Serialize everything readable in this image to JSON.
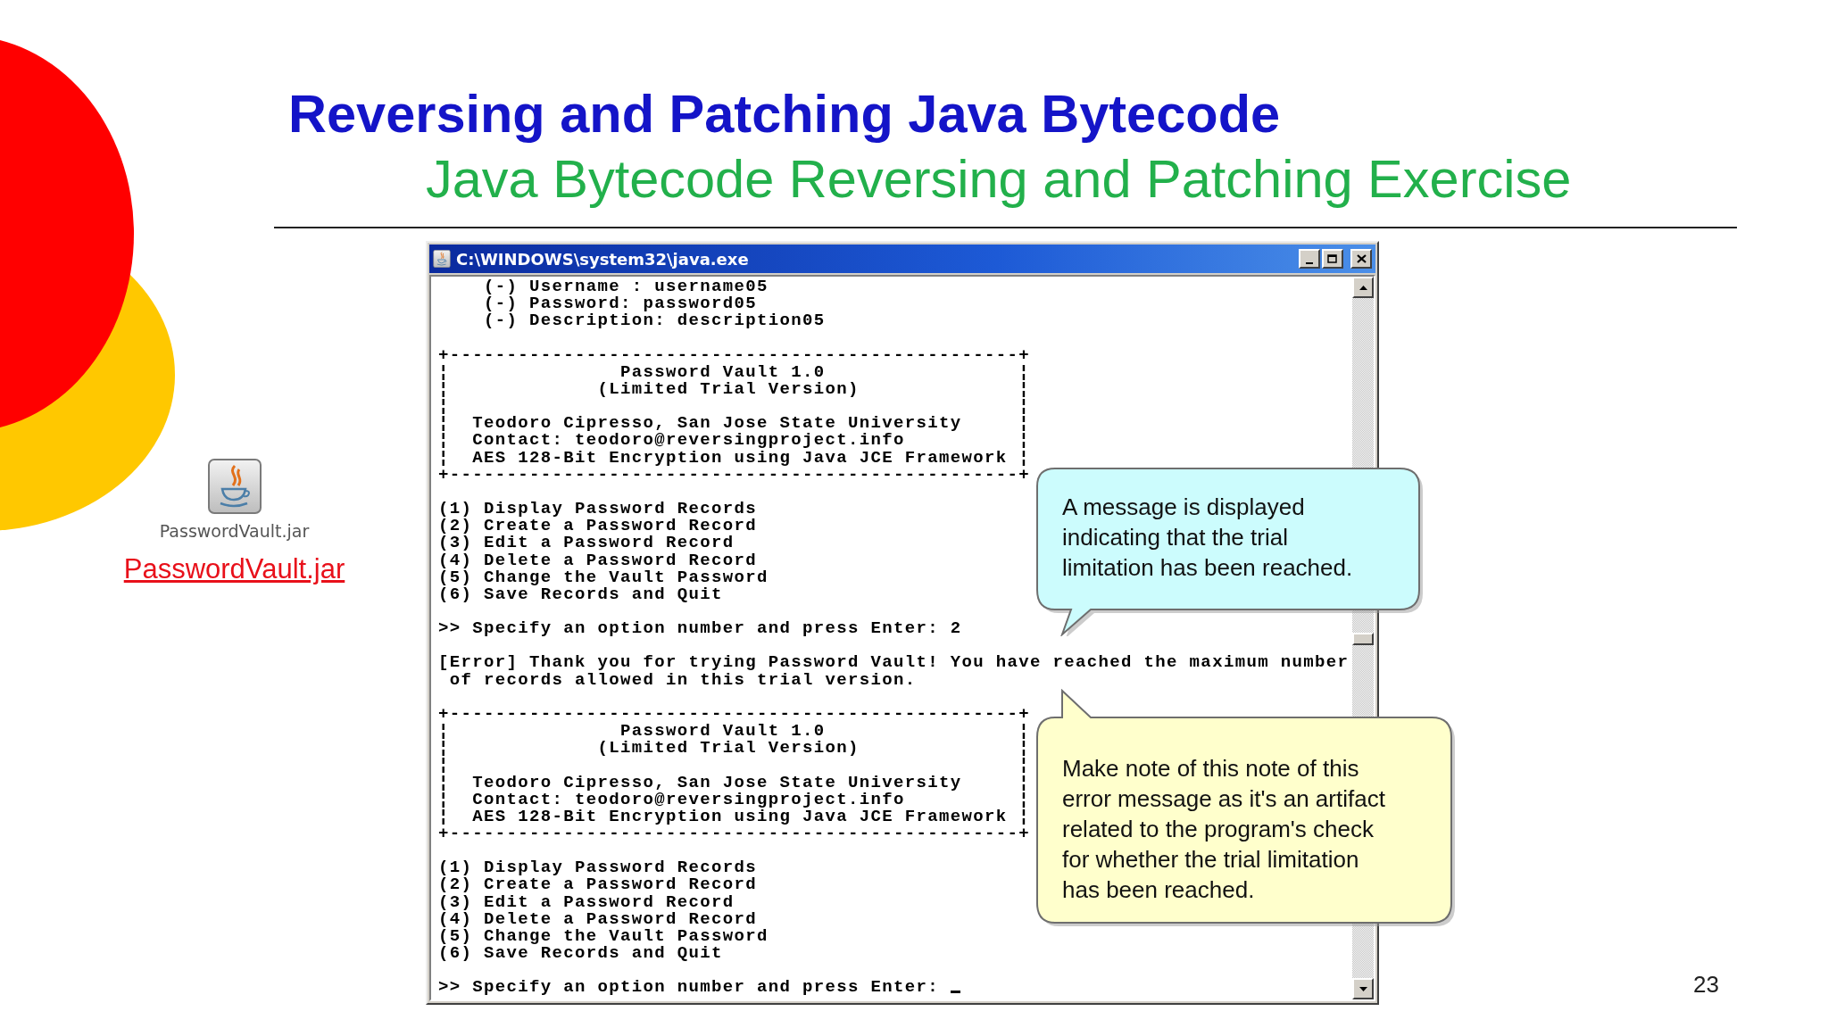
{
  "slide": {
    "title": "Reversing and Patching Java Bytecode",
    "subtitle": "Java Bytecode Reversing and Patching Exercise",
    "page_number": "23"
  },
  "file_icon": {
    "label": "PasswordVault.jar"
  },
  "link": {
    "text": "PasswordVault.jar"
  },
  "console": {
    "title": "C:\\WINDOWS\\system32\\java.exe",
    "lines": [
      {
        "kind": "text",
        "text": "    (-) Username : username05"
      },
      {
        "kind": "text",
        "text": "    (-) Password: password05"
      },
      {
        "kind": "text",
        "text": "    (-) Description: description05"
      },
      {
        "kind": "blank"
      },
      {
        "kind": "text",
        "text": "+--------------------------------------------------+"
      },
      {
        "kind": "text",
        "text": "¦               Password Vault 1.0                 ¦"
      },
      {
        "kind": "text",
        "text": "¦             (Limited Trial Version)              ¦"
      },
      {
        "kind": "text",
        "text": "¦                                                  ¦"
      },
      {
        "kind": "text",
        "text": "¦  Teodoro Cipresso, San Jose State University     ¦"
      },
      {
        "kind": "text",
        "text": "¦  Contact: teodoro@reversingproject.info          ¦"
      },
      {
        "kind": "text",
        "text": "¦  AES 128-Bit Encryption using Java JCE Framework ¦"
      },
      {
        "kind": "text",
        "text": "+--------------------------------------------------+"
      },
      {
        "kind": "blank"
      },
      {
        "kind": "text",
        "text": "(1) Display Password Records"
      },
      {
        "kind": "text",
        "text": "(2) Create a Password Record"
      },
      {
        "kind": "text",
        "text": "(3) Edit a Password Record"
      },
      {
        "kind": "text",
        "text": "(4) Delete a Password Record"
      },
      {
        "kind": "text",
        "text": "(5) Change the Vault Password"
      },
      {
        "kind": "text",
        "text": "(6) Save Records and Quit"
      },
      {
        "kind": "blank"
      },
      {
        "kind": "text",
        "text": ">> Specify an option number and press Enter: 2"
      },
      {
        "kind": "blank"
      },
      {
        "kind": "text",
        "text": "[Error] Thank you for trying Password Vault! You have reached the maximum number"
      },
      {
        "kind": "text",
        "text": " of records allowed in this trial version."
      },
      {
        "kind": "blank"
      },
      {
        "kind": "text",
        "text": "+--------------------------------------------------+"
      },
      {
        "kind": "text",
        "text": "¦               Password Vault 1.0                 ¦"
      },
      {
        "kind": "text",
        "text": "¦             (Limited Trial Version)              ¦"
      },
      {
        "kind": "text",
        "text": "¦                                                  ¦"
      },
      {
        "kind": "text",
        "text": "¦  Teodoro Cipresso, San Jose State University     ¦"
      },
      {
        "kind": "text",
        "text": "¦  Contact: teodoro@reversingproject.info          ¦"
      },
      {
        "kind": "text",
        "text": "¦  AES 128-Bit Encryption using Java JCE Framework ¦"
      },
      {
        "kind": "text",
        "text": "+--------------------------------------------------+"
      },
      {
        "kind": "blank"
      },
      {
        "kind": "text",
        "text": "(1) Display Password Records"
      },
      {
        "kind": "text",
        "text": "(2) Create a Password Record"
      },
      {
        "kind": "text",
        "text": "(3) Edit a Password Record"
      },
      {
        "kind": "text",
        "text": "(4) Delete a Password Record"
      },
      {
        "kind": "text",
        "text": "(5) Change the Vault Password"
      },
      {
        "kind": "text",
        "text": "(6) Save Records and Quit"
      },
      {
        "kind": "blank"
      },
      {
        "kind": "prompt",
        "text": ">> Specify an option number and press Enter: "
      }
    ]
  },
  "callouts": [
    {
      "kind": "info",
      "text": "A message is displayed indicating that the trial limitation has been reached."
    },
    {
      "kind": "note",
      "text": "Make note of this note of this error message as it's an artifact related to the program's check for whether the trial limitation has been reached."
    }
  ]
}
